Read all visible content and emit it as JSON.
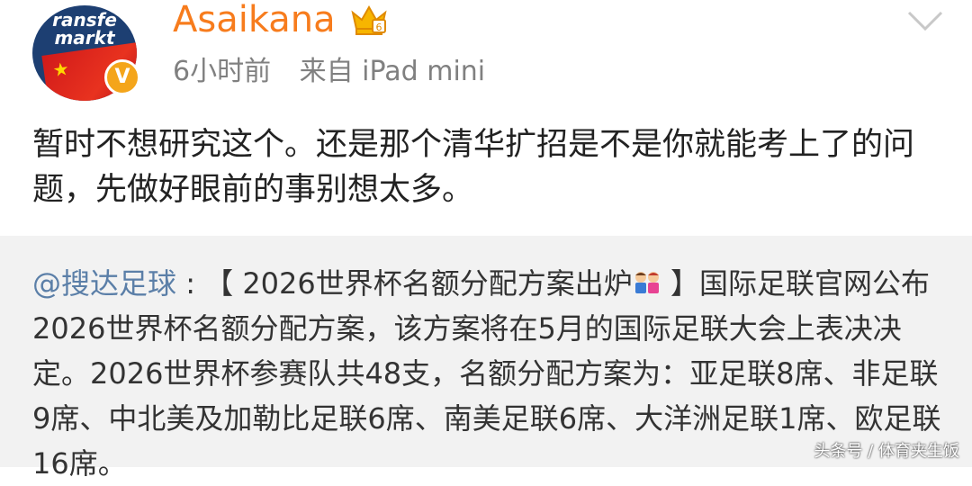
{
  "post": {
    "avatar_logo_line1": "ransfe",
    "avatar_logo_line2": "markt",
    "verified_badge": "V",
    "username": "Asaikana",
    "time": "6小时前",
    "source": "来自 iPad mini",
    "body": "暂时不想研究这个。还是那个清华扩招是不是你就能考上了的问题，先做好眼前的事别想太多。"
  },
  "repost": {
    "mention": "@搜达足球",
    "separator": " : ",
    "title_open": "【 2026世界杯名额分配方案出炉",
    "title_close": " 】",
    "text": "国际足联官网公布2026世界杯名额分配方案，该方案将在5月的国际足联大会上表决决定。2026世界杯参赛队共48支，名额分配方案为：亚足联8席、非足联9席、中北美及加勒比足联6席、南美足联6席、大洋洲足联1席、欧足联16席。"
  },
  "watermark": "头条号 / 体育夹生饭",
  "icons": {
    "crown": "crown-icon",
    "chevron": "chevron-down-icon",
    "emoji": "kids-emoji-icon",
    "flag_star": "star-icon"
  },
  "colors": {
    "username": "#f77c1d",
    "mention": "#5b7fa8",
    "meta": "#808080",
    "repost_bg": "#f2f2f2",
    "badge": "#f4a51b"
  }
}
